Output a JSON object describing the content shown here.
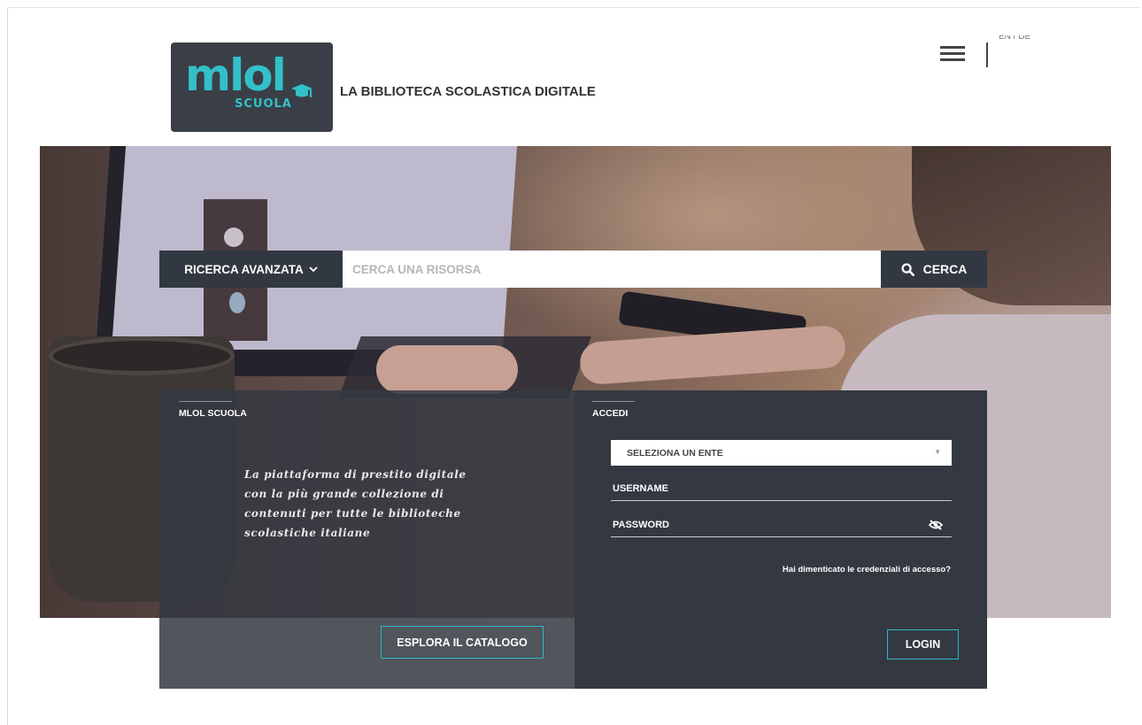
{
  "header": {
    "logo_main": "mlol",
    "logo_sub": "SCUOLA",
    "tagline": "LA BIBLIOTECA SCOLASTICA DIGITALE",
    "lang_partial": "EN / DE"
  },
  "search": {
    "advanced_label": "RICERCA AVANZATA",
    "placeholder": "CERCA UNA RISORSA",
    "button_label": "CERCA"
  },
  "left_panel": {
    "title": "MLOL SCUOLA",
    "promo_lines": [
      "La piattaforma di prestito digitale",
      "con la più grande collezione di",
      "contenuti per tutte le biblioteche",
      "scolastiche italiane"
    ],
    "explore_label": "ESPLORA IL CATALOGO"
  },
  "login_panel": {
    "title": "ACCEDI",
    "select_value": "SELEZIONA UN ENTE",
    "username_label": "USERNAME",
    "password_label": "PASSWORD",
    "forgot_label": "Hai dimenticato le credenziali di accesso?",
    "login_label": "LOGIN"
  },
  "colors": {
    "accent": "#33c0c9",
    "dark_panel": "#343941",
    "button_border": "#2ab8c6"
  },
  "icons": {
    "menu": "hamburger-icon",
    "search": "search-icon",
    "chevron": "chevron-down-icon",
    "eye": "eye-off-icon",
    "cap": "graduation-cap-icon"
  }
}
